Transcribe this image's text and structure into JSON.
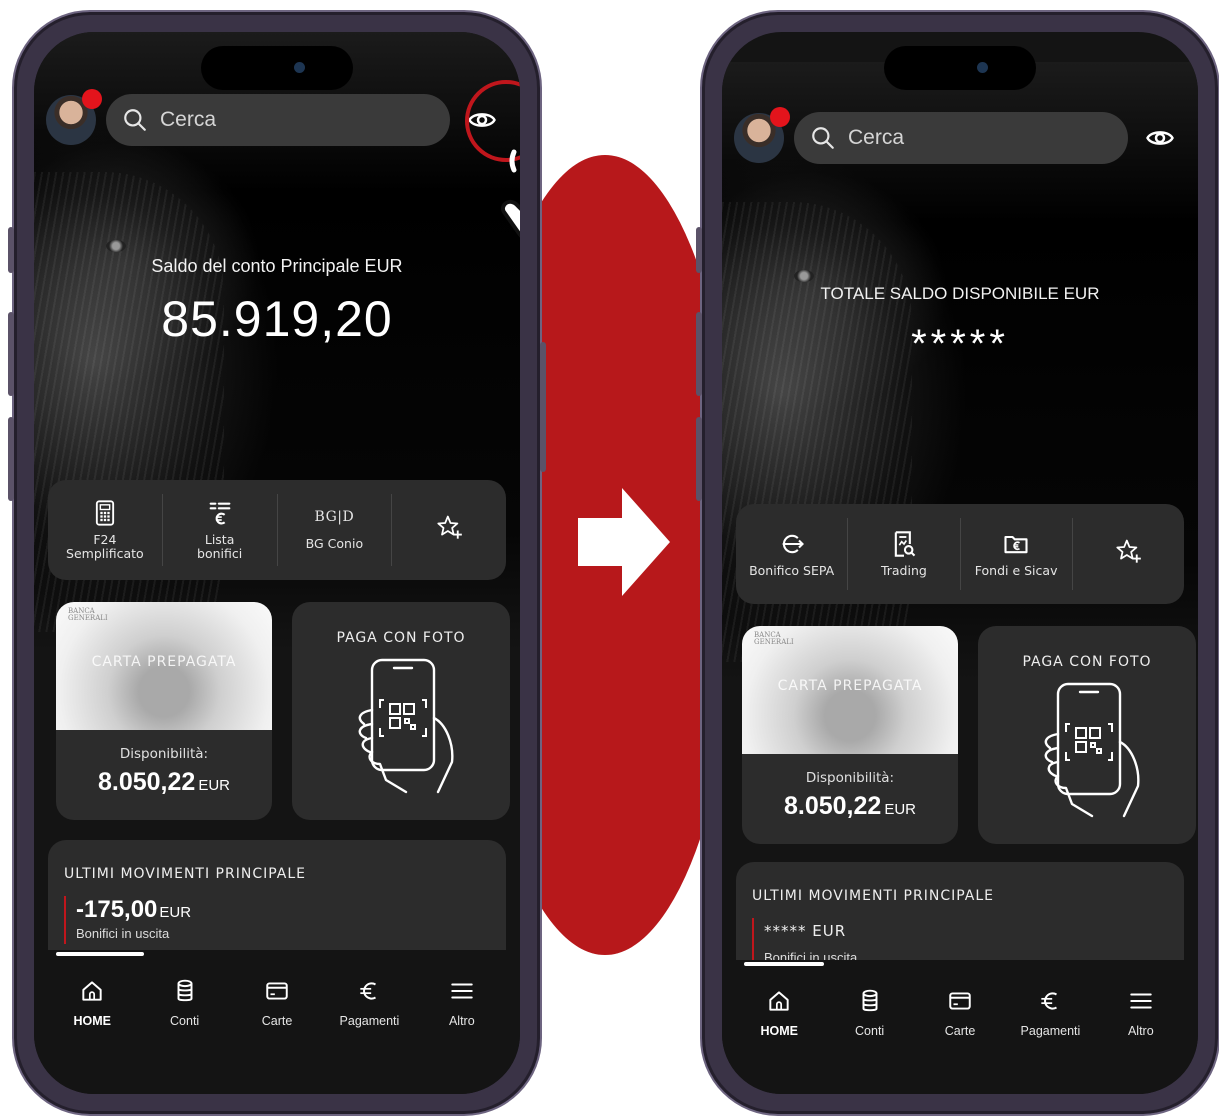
{
  "colors": {
    "accent_red": "#c0161c",
    "background": "#141414",
    "card": "#2c2c2c"
  },
  "transition_arrow_icon": "right-arrow-icon",
  "before": {
    "search": {
      "placeholder": "Cerca",
      "icon": "search-icon"
    },
    "visibility_toggle": {
      "icon": "eye-icon",
      "highlighted": true
    },
    "balance": {
      "label": "Saldo del conto Principale EUR",
      "value": "85.919,20"
    },
    "shortcuts": [
      {
        "icon": "f24-calculator-icon",
        "label": "F24\nSemplificato"
      },
      {
        "icon": "euro-list-icon",
        "label": "Lista\nbonifici"
      },
      {
        "icon": "bg-conio-logo",
        "logo": "BG|D",
        "label": "BG Conio"
      },
      {
        "icon": "star-plus-icon",
        "label": ""
      }
    ],
    "prepaid_card": {
      "brand": "BANCA GENERALI",
      "title": "CARTA PREPAGATA",
      "availability_label": "Disponibilità:",
      "availability_value": "8.050,22",
      "currency": "EUR"
    },
    "pay_by_photo": {
      "title": "PAGA CON FOTO",
      "icon": "phone-qr-hand-icon"
    },
    "movements": {
      "title": "ULTIMI MOVIMENTI PRINCIPALE",
      "amount": "-175,00",
      "currency": "EUR",
      "description": "Bonifici in uscita"
    },
    "tabs": [
      {
        "icon": "home-icon",
        "label": "HOME",
        "active": true
      },
      {
        "icon": "coins-icon",
        "label": "Conti",
        "active": false
      },
      {
        "icon": "card-icon",
        "label": "Carte",
        "active": false
      },
      {
        "icon": "euro-icon",
        "label": "Pagamenti",
        "active": false
      },
      {
        "icon": "menu-icon",
        "label": "Altro",
        "active": false
      }
    ]
  },
  "after": {
    "search": {
      "placeholder": "Cerca",
      "icon": "search-icon"
    },
    "visibility_toggle": {
      "icon": "eye-icon",
      "highlighted": false
    },
    "balance": {
      "label": "TOTALE SALDO DISPONIBILE EUR",
      "value": "*****"
    },
    "shortcuts": [
      {
        "icon": "euro-transfer-icon",
        "label": "Bonifico SEPA"
      },
      {
        "icon": "trading-doc-icon",
        "label": "Trading"
      },
      {
        "icon": "euro-folder-icon",
        "label": "Fondi e Sicav"
      },
      {
        "icon": "star-plus-icon",
        "label": ""
      }
    ],
    "prepaid_card": {
      "brand": "BANCA GENERALI",
      "title": "CARTA PREPAGATA",
      "availability_label": "Disponibilità:",
      "availability_value": "8.050,22",
      "currency": "EUR"
    },
    "pay_by_photo": {
      "title": "PAGA CON FOTO",
      "icon": "phone-qr-hand-icon"
    },
    "movements": {
      "title": "ULTIMI MOVIMENTI PRINCIPALE",
      "amount": "*****",
      "currency": "EUR",
      "description": "Bonifici in uscita"
    },
    "tabs": [
      {
        "icon": "home-icon",
        "label": "HOME",
        "active": true
      },
      {
        "icon": "coins-icon",
        "label": "Conti",
        "active": false
      },
      {
        "icon": "card-icon",
        "label": "Carte",
        "active": false
      },
      {
        "icon": "euro-icon",
        "label": "Pagamenti",
        "active": false
      },
      {
        "icon": "menu-icon",
        "label": "Altro",
        "active": false
      }
    ]
  }
}
